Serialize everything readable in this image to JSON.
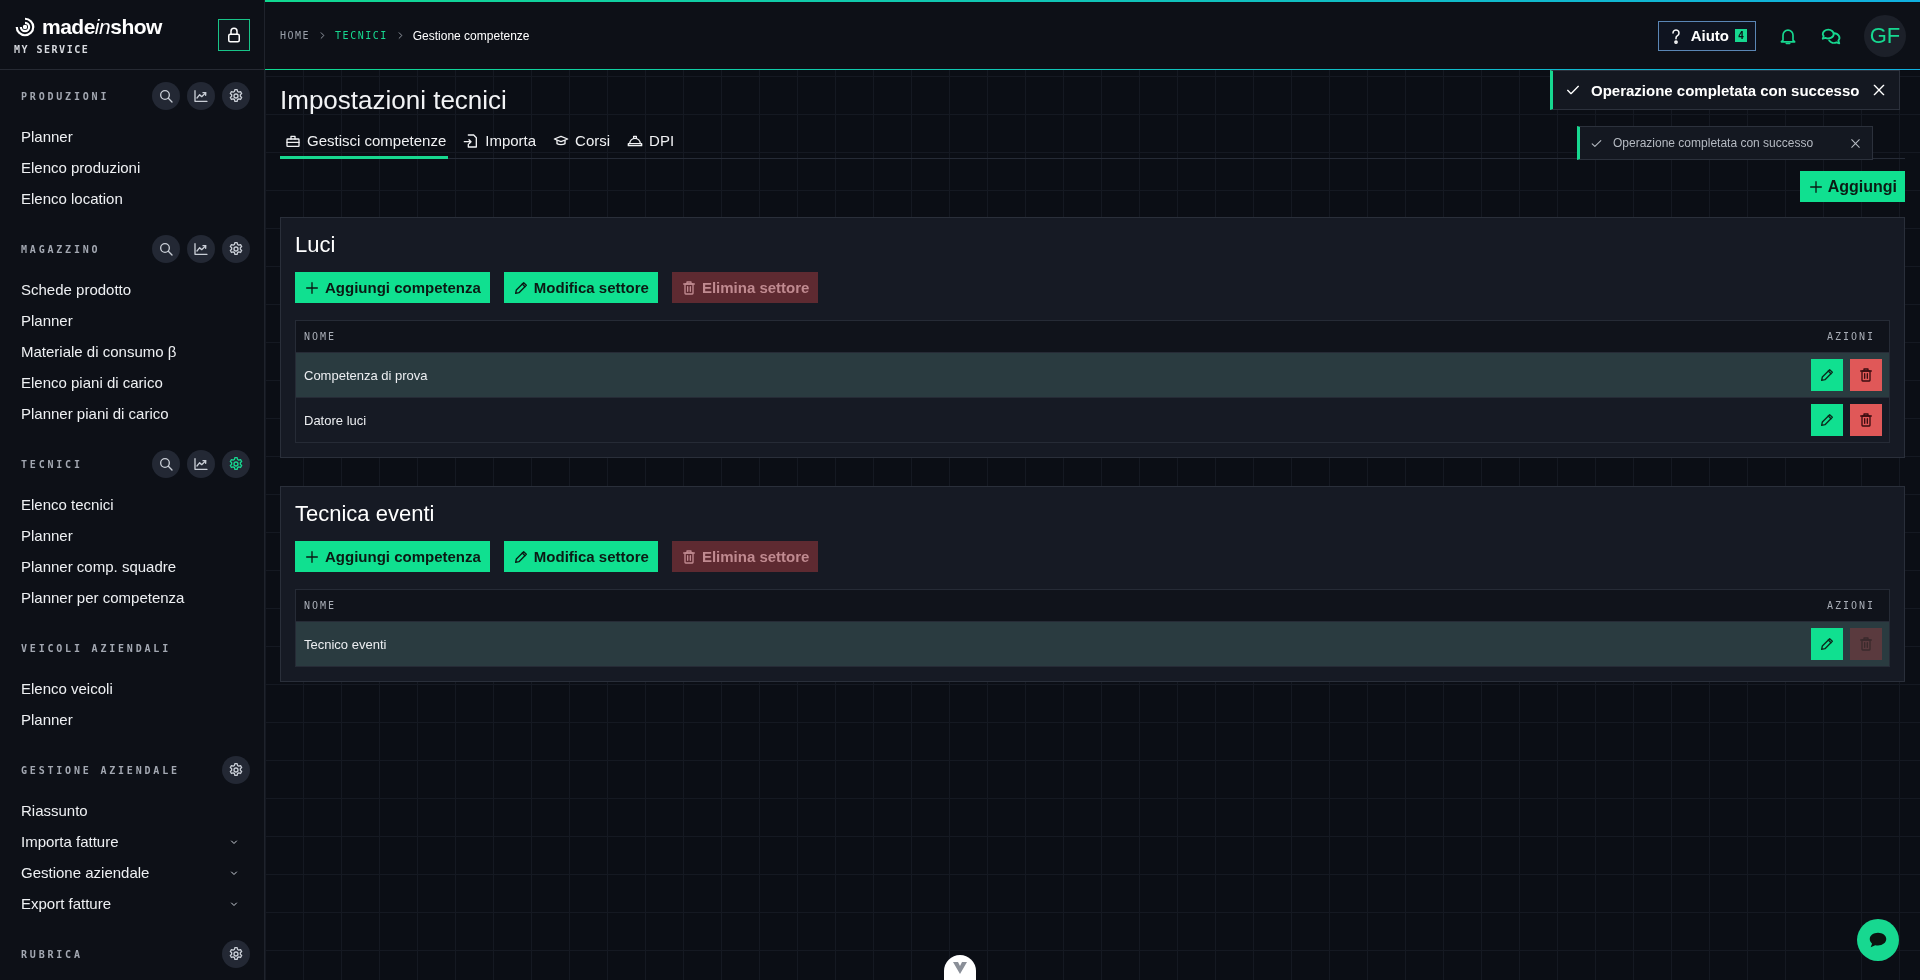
{
  "sidebar": {
    "brand": [
      {
        "text": "made",
        "italic": false
      },
      {
        "text": "in",
        "italic": true
      },
      {
        "text": "show",
        "italic": false
      }
    ],
    "subtitle": "MY SERVICE",
    "sections": [
      {
        "title": "PRODUZIONI",
        "actions": [
          {
            "kind": "search",
            "active": false
          },
          {
            "kind": "chart",
            "active": false
          },
          {
            "kind": "settings",
            "active": false
          }
        ],
        "items": [
          {
            "label": "Planner",
            "kind": "link"
          },
          {
            "label": "Elenco produzioni",
            "kind": "link"
          },
          {
            "label": "Elenco location",
            "kind": "link"
          }
        ]
      },
      {
        "title": "MAGAZZINO",
        "actions": [
          {
            "kind": "search",
            "active": false
          },
          {
            "kind": "chart",
            "active": false
          },
          {
            "kind": "settings",
            "active": false
          }
        ],
        "items": [
          {
            "label": "Schede prodotto",
            "kind": "link"
          },
          {
            "label": "Planner",
            "kind": "link"
          },
          {
            "label": "Materiale di consumo β",
            "kind": "link"
          },
          {
            "label": "Elenco piani di carico",
            "kind": "link"
          },
          {
            "label": "Planner piani di carico",
            "kind": "link"
          }
        ]
      },
      {
        "title": "TECNICI",
        "actions": [
          {
            "kind": "search",
            "active": false
          },
          {
            "kind": "chart",
            "active": false
          },
          {
            "kind": "settings",
            "active": true
          }
        ],
        "items": [
          {
            "label": "Elenco tecnici",
            "kind": "link"
          },
          {
            "label": "Planner",
            "kind": "link"
          },
          {
            "label": "Planner comp. squadre",
            "kind": "link"
          },
          {
            "label": "Planner per competenza",
            "kind": "link"
          }
        ]
      },
      {
        "title": "VEICOLI AZIENDALI",
        "items": [
          {
            "label": "Elenco veicoli",
            "kind": "link"
          },
          {
            "label": "Planner",
            "kind": "link"
          }
        ]
      },
      {
        "title": "GESTIONE AZIENDALE",
        "actions": [
          {
            "kind": "settings",
            "active": false
          }
        ],
        "items": [
          {
            "label": "Riassunto",
            "kind": "link"
          },
          {
            "label": "Importa fatture",
            "kind": "submenu"
          },
          {
            "label": "Gestione aziendale",
            "kind": "submenu"
          },
          {
            "label": "Export fatture",
            "kind": "submenu"
          }
        ]
      },
      {
        "title": "RUBRICA",
        "actions": [
          {
            "kind": "settings",
            "active": false
          }
        ]
      }
    ]
  },
  "header": {
    "breadcrumb": [
      {
        "label": "HOME",
        "kind": "link"
      },
      {
        "label": "TECNICI",
        "kind": "active-link"
      },
      {
        "label": "Gestione competenze",
        "kind": "current"
      }
    ],
    "help": {
      "label": "Aiuto",
      "badge": "4"
    },
    "avatar": "GF"
  },
  "toasts": [
    {
      "message": "Operazione completata con successo",
      "kind": "primary"
    },
    {
      "message": "Operazione completata con successo",
      "kind": "faded"
    }
  ],
  "page": {
    "title": "Impostazioni tecnici",
    "tabs": [
      {
        "label": "Gestisci competenze",
        "kind": "toolbox",
        "selected": true
      },
      {
        "label": "Importa",
        "kind": "import",
        "selected": false
      },
      {
        "label": "Corsi",
        "kind": "cap",
        "selected": false
      },
      {
        "label": "DPI",
        "kind": "helmet",
        "selected": false
      }
    ],
    "add_button": "Aggiungi",
    "sectors": [
      {
        "title": "Luci",
        "buttons": [
          {
            "label": "Aggiungi competenza",
            "kind": "add",
            "disabled": false
          },
          {
            "label": "Modifica settore",
            "kind": "edit",
            "disabled": false
          },
          {
            "label": "Elimina settore",
            "kind": "delete",
            "disabled": true
          }
        ],
        "columns": [
          "NOME",
          "AZIONI"
        ],
        "rows": [
          {
            "name": "Competenza di prova",
            "highlighted": true,
            "delete_disabled": false
          },
          {
            "name": "Datore luci",
            "highlighted": false,
            "delete_disabled": false
          }
        ]
      },
      {
        "title": "Tecnica eventi",
        "buttons": [
          {
            "label": "Aggiungi competenza",
            "kind": "add",
            "disabled": false
          },
          {
            "label": "Modifica settore",
            "kind": "edit",
            "disabled": false
          },
          {
            "label": "Elimina settore",
            "kind": "delete",
            "disabled": true
          }
        ],
        "columns": [
          "NOME",
          "AZIONI"
        ],
        "rows": [
          {
            "name": "Tecnico eventi",
            "highlighted": true,
            "delete_disabled": true
          }
        ]
      }
    ]
  }
}
